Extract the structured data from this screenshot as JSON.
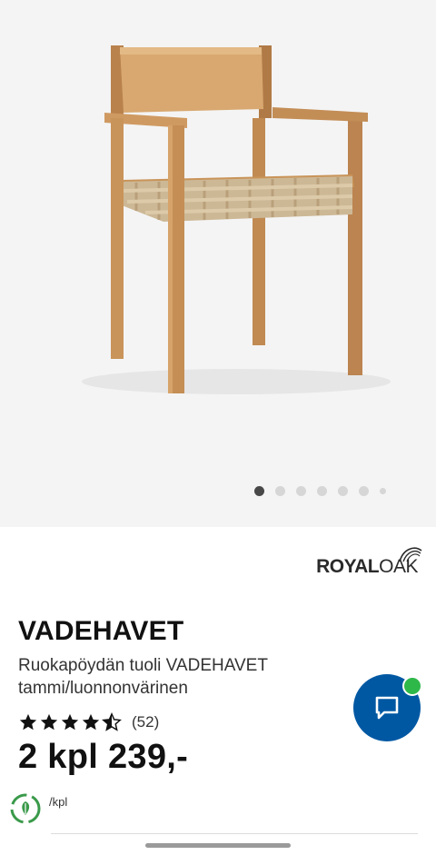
{
  "gallery": {
    "image_alt": "Ruokapöydän tuoli VADEHAVET tammi/luonnonvärinen",
    "slides_total": 7,
    "active_slide": 1
  },
  "brand": {
    "part1": "ROYAL",
    "part2": "OAK"
  },
  "product": {
    "name": "VADEHAVET",
    "description_line1": "Ruokapöydän tuoli VADEHAVET",
    "description_line2": "tammi/luonnonvärinen",
    "rating_value": 4.5,
    "rating_max": 5,
    "review_count": "(52)",
    "price": "2 kpl 239,-",
    "unit": "/kpl"
  },
  "chat": {
    "icon": "chat-bubble-icon",
    "status": "online",
    "status_color": "#2fb84a",
    "button_color": "#0058a3"
  },
  "icons": {
    "sustainability": "recycle-leaf-icon",
    "star": "star-icon"
  }
}
